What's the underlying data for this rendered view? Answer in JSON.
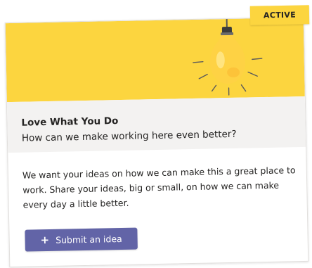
{
  "badge": {
    "label": "ACTIVE"
  },
  "card": {
    "title": "Love What You Do",
    "subtitle": "How can we make working here even better?",
    "description": "We want your ideas on how we can make this a great place to work. Share your ideas, big or small, on how we can make every day a little better.",
    "submit_label": "Submit an idea",
    "submit_icon": "plus-icon",
    "hero_icon": "lightbulb-icon"
  },
  "colors": {
    "hero_bg": "#fcd53f",
    "bulb": "#fdd835",
    "accent_button": "#6264a7",
    "title_band": "#f3f2f1"
  }
}
